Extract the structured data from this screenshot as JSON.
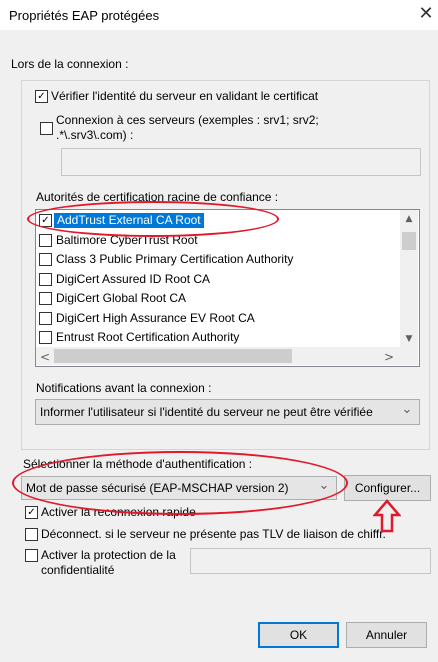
{
  "window": {
    "title": "Propriétés EAP protégées",
    "close_glyph": "✕"
  },
  "connection": {
    "group_label": "Lors de la connexion :",
    "verify_server": {
      "label": "Vérifier l'identité du serveur en validant le certificat",
      "checked": true
    },
    "connect_servers": {
      "label_line1": "Connexion à ces serveurs (exemples : srv1; srv2;",
      "label_line2": ".*\\.srv3\\.com) :",
      "checked": false,
      "value": ""
    },
    "ca_label": "Autorités de certification racine de confiance :",
    "ca_list": [
      {
        "label": "AddTrust External CA Root",
        "checked": true,
        "selected": true
      },
      {
        "label": "Baltimore CyberTrust Root",
        "checked": false
      },
      {
        "label": "Class 3 Public Primary Certification Authority",
        "checked": false
      },
      {
        "label": "DigiCert Assured ID Root CA",
        "checked": false
      },
      {
        "label": "DigiCert Global Root CA",
        "checked": false
      },
      {
        "label": "DigiCert High Assurance EV Root CA",
        "checked": false
      },
      {
        "label": "Entrust Root Certification Authority",
        "checked": false
      }
    ],
    "notifications_label": "Notifications avant la connexion :",
    "notifications_value": "Informer l'utilisateur si l'identité du serveur ne peut être vérifiée"
  },
  "auth": {
    "label": "Sélectionner la méthode d'authentification :",
    "method_value": "Mot de passe sécurisé (EAP-MSCHAP version 2)",
    "configure_label": "Configurer..."
  },
  "options": {
    "fast_reconnect": {
      "label": "Activer la reconnexion rapide",
      "checked": true
    },
    "disconnect_tlv": {
      "label": "Déconnect. si le serveur ne présente pas TLV de liaison de chiffr.",
      "checked": false
    },
    "privacy": {
      "label_line1": "Activer la protection de la",
      "label_line2": "confidentialité",
      "checked": false,
      "value": ""
    }
  },
  "buttons": {
    "ok": "OK",
    "cancel": "Annuler"
  },
  "glyphs": {
    "check": "✓",
    "chevron_down": "⌄",
    "arrow_up": "▲",
    "arrow_down": "▼",
    "arrow_left": "<",
    "arrow_right": ">"
  },
  "colors": {
    "annotation_red": "#e0192b",
    "selection_blue": "#0078d7"
  }
}
